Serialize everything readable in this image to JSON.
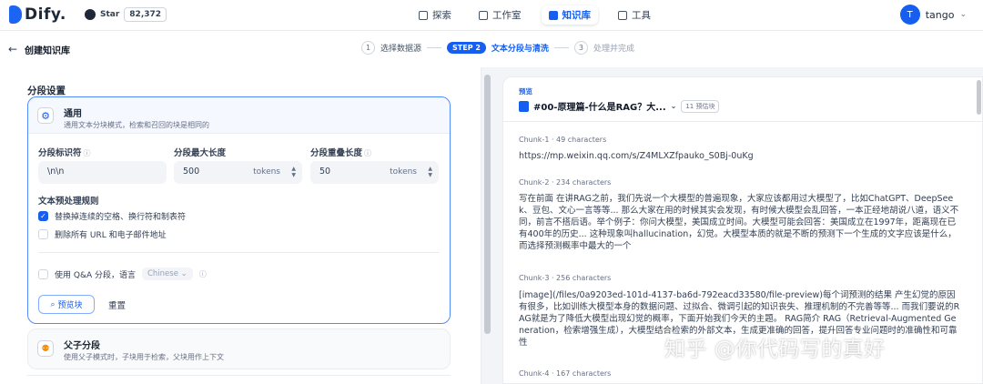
{
  "app": {
    "name": "Dify",
    "name_suffix": "."
  },
  "github": {
    "star_label": "Star",
    "count": "82,372"
  },
  "nav": [
    {
      "label": "探索",
      "icon": "compass-icon"
    },
    {
      "label": "工作室",
      "icon": "robot-icon"
    },
    {
      "label": "知识库",
      "icon": "book-icon"
    },
    {
      "label": "工具",
      "icon": "hammer-icon"
    }
  ],
  "user": {
    "initial": "T",
    "name": "tango"
  },
  "page": {
    "back_icon": "←",
    "title": "创建知识库"
  },
  "steps": {
    "s1_num": "1",
    "s1_label": "选择数据源",
    "s2_badge": "STEP 2",
    "s2_label": "文本分段与清洗",
    "s3_num": "3",
    "s3_label": "处理并完成"
  },
  "segment": {
    "section_title": "分段设置",
    "general": {
      "title": "通用",
      "desc": "通用文本分块模式，检索和召回的块是相同的",
      "separator_label": "分段标识符",
      "separator_value": "\\n\\n",
      "maxlen_label": "分段最大长度",
      "maxlen_value": "500",
      "overlap_label": "分段重叠长度",
      "overlap_value": "50",
      "unit": "tokens",
      "pre_title": "文本预处理规则",
      "rule1": "替换掉连续的空格、换行符和制表符",
      "rule2": "删除所有 URL 和电子邮件地址",
      "qa_label": "使用 Q&A 分段，语言",
      "qa_lang": "Chinese",
      "preview_btn": "预览块",
      "reset_btn": "重置"
    },
    "parent": {
      "title": "父子分段",
      "desc": "使用父子模式时，子块用于检索，父块用作上下文"
    }
  },
  "preview": {
    "label": "预览",
    "doc_title": "#00-原理篇-什么是RAG？大...",
    "est_chunks": "11 预估块",
    "chunks": [
      {
        "name": "Chunk-1",
        "chars": "49 characters",
        "text": "https://mp.weixin.qq.com/s/Z4MLXZfpauko_S0Bj-0uKg"
      },
      {
        "name": "Chunk-2",
        "chars": "234 characters",
        "text": "写在前面 在讲RAG之前，我们先说一个大模型的普遍现象，大家应该都用过大模型了，比如ChatGPT、DeepSeek、豆包、文心一言等等... 那么大家在用的时候其实会发现，有时候大模型会乱回答，一本正经地胡说八道，语义不同，前言不搭后语。举个例子：你问大模型，美国成立时间。大模型可能会回答：美国成立在1997年，距离现在已有400年的历史... 这种现象叫hallucination，幻觉。大模型本质的就是不断的预测下一个生成的文字应该是什么，而选择预测概率中最大的一个"
      },
      {
        "name": "Chunk-3",
        "chars": "256 characters",
        "text": "[image](/files/0a9203ed-101d-4137-ba6d-792eacd33580/file-preview)每个词预测的结果 产生幻觉的原因有很多，比如训练大模型本身的数据问题、过拟合、微调引起的知识丧失、推理机制的不完善等等... 而我们要说的RAG就是为了降低大模型出现幻觉的概率，下面开始我们今天的主题。 RAG简介 RAG（Retrieval-Augmented Generation，检索增强生成），大模型结合检索的外部文本，生成更准确的回答，提升回答专业问题时的准确性和可靠性"
      },
      {
        "name": "Chunk-4",
        "chars": "167 characters",
        "text": ""
      }
    ]
  },
  "watermark": "知乎 @你代码写的真好"
}
